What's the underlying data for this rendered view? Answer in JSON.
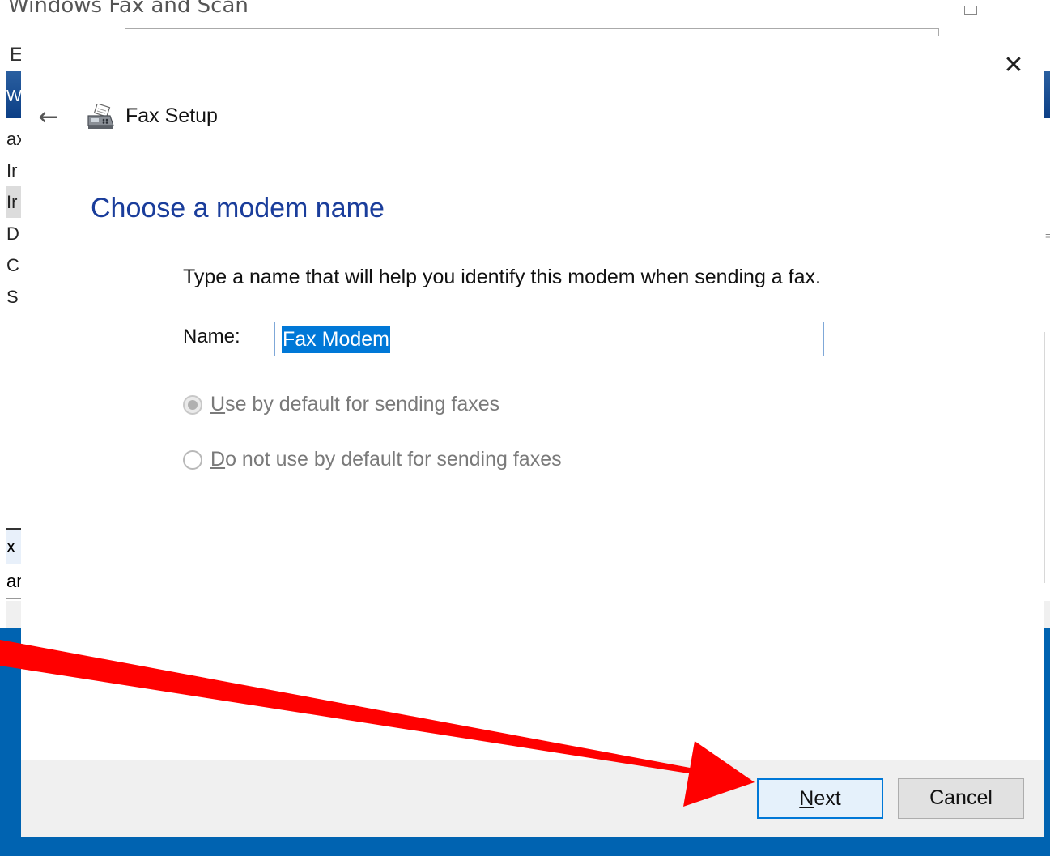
{
  "background_window": {
    "title": "Windows Fax and Scan",
    "menu_letter": "E",
    "left_strip_text": "W",
    "tree_items": [
      "ax",
      "Ir",
      "Ir",
      "D",
      "C",
      "S"
    ],
    "lower_items": [
      "x",
      "an"
    ]
  },
  "dialog": {
    "title": "Fax Setup",
    "back_glyph": "←",
    "close_glyph": "✕",
    "heading": "Choose a modem name",
    "instruction": "Type a name that will help you identify this modem when sending a fax.",
    "name_label": "Name:",
    "name_value": "Fax Modem",
    "radio_options": [
      {
        "accesskey": "U",
        "rest": "se by default for sending faxes",
        "checked": true,
        "enabled": false
      },
      {
        "accesskey": "D",
        "rest": "o not use by default for sending faxes",
        "checked": false,
        "enabled": false
      }
    ],
    "buttons": {
      "next_accesskey": "N",
      "next_rest": "ext",
      "cancel": "Cancel"
    }
  },
  "colors": {
    "heading": "#1a3d9b",
    "accent": "#0078d7",
    "annotation_arrow": "#ff0000",
    "taskbar_blue": "#0063b1"
  },
  "icons": [
    "fax-icon",
    "back-arrow-icon",
    "close-icon",
    "annotation-arrow"
  ]
}
